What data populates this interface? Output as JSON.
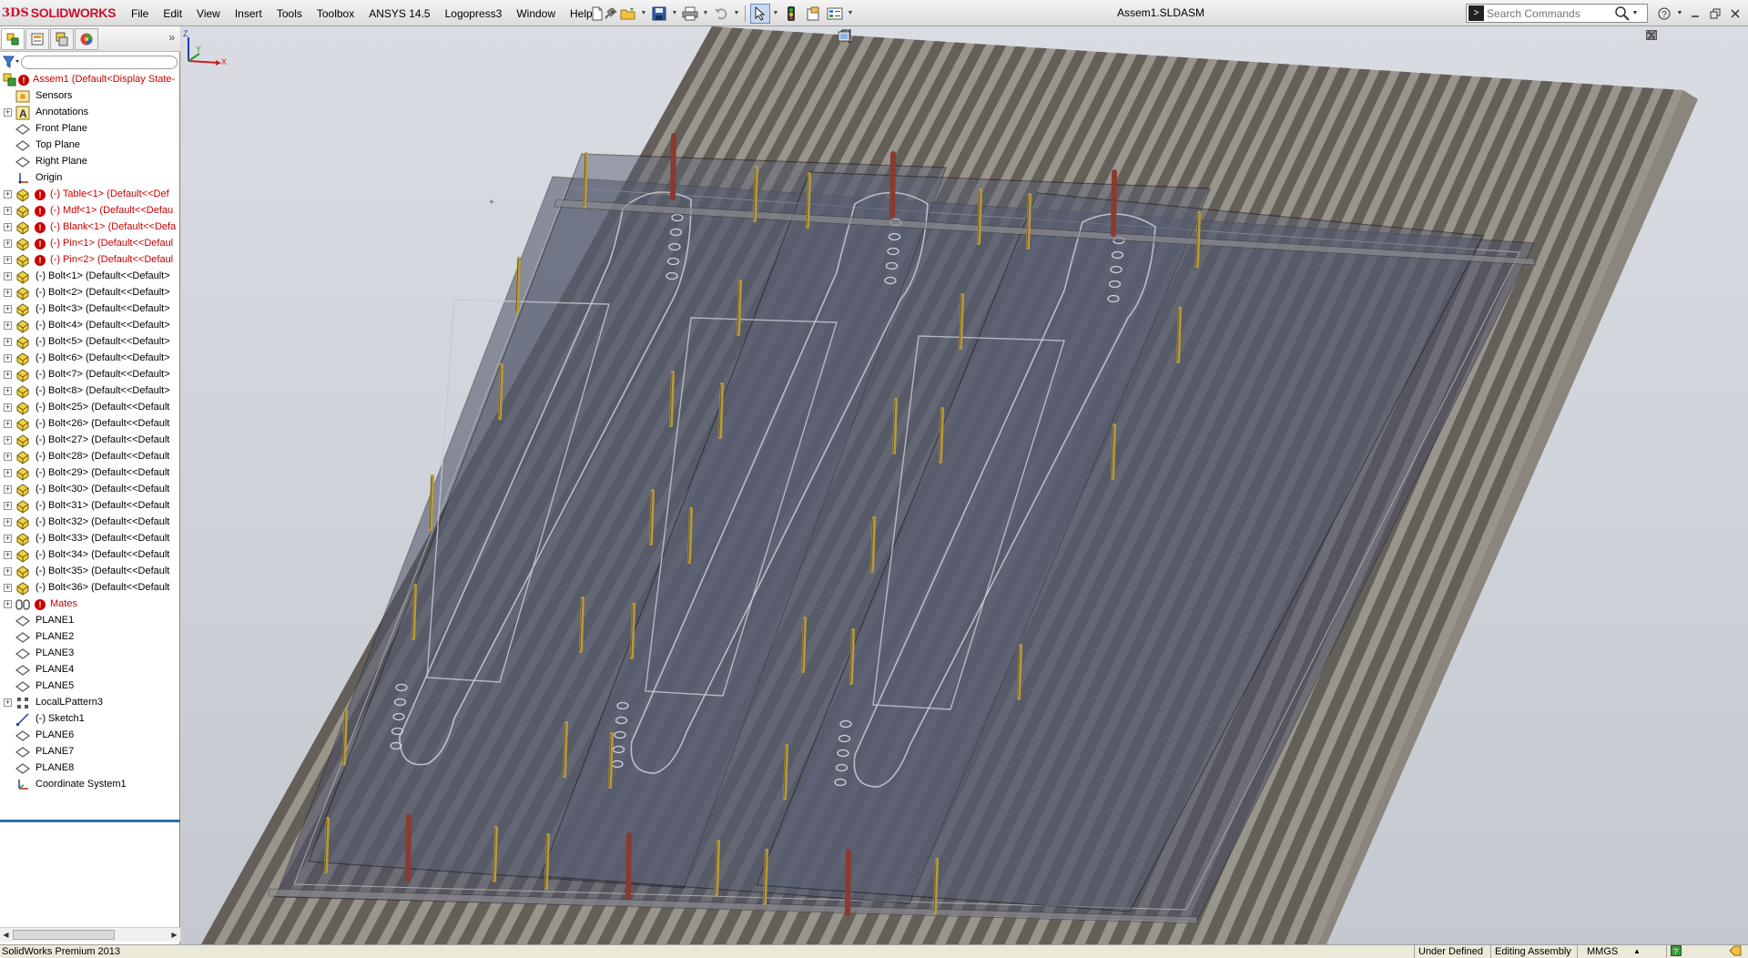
{
  "app": {
    "logo_mark": "3DS",
    "logo_text": "SOLIDWORKS",
    "document_title": "Assem1.SLDASM"
  },
  "menu": {
    "items": [
      "File",
      "Edit",
      "View",
      "Insert",
      "Tools",
      "Toolbox",
      "ANSYS 14.5",
      "Logopress3",
      "Window",
      "Help"
    ]
  },
  "search": {
    "placeholder": "Search Commands"
  },
  "feature_tree": {
    "items": [
      {
        "label": "Assem1  (Default<Display State-",
        "icon": "assembly-icon",
        "error": true,
        "red": true
      },
      {
        "label": "Sensors",
        "icon": "sensors-icon"
      },
      {
        "label": "Annotations",
        "icon": "annotations-icon",
        "expand": true
      },
      {
        "label": "Front Plane",
        "icon": "plane-icon"
      },
      {
        "label": "Top Plane",
        "icon": "plane-icon"
      },
      {
        "label": "Right Plane",
        "icon": "plane-icon"
      },
      {
        "label": "Origin",
        "icon": "origin-icon"
      },
      {
        "label": "(-) Table<1> (Default<<Def",
        "icon": "part-icon",
        "expand": true,
        "error": true,
        "red": true
      },
      {
        "label": "(-) Mdf<1> (Default<<Defau",
        "icon": "part-icon",
        "expand": true,
        "error": true,
        "red": true
      },
      {
        "label": "(-) Blank<1> (Default<<Defa",
        "icon": "part-icon",
        "expand": true,
        "error": true,
        "red": true
      },
      {
        "label": "(-) Pin<1> (Default<<Defaul",
        "icon": "part-icon",
        "expand": true,
        "error": true,
        "red": true
      },
      {
        "label": "(-) Pin<2> (Default<<Defaul",
        "icon": "part-icon",
        "expand": true,
        "error": true,
        "red": true
      },
      {
        "label": "(-) Bolt<1> (Default<<Default>",
        "icon": "part-icon",
        "expand": true
      },
      {
        "label": "(-) Bolt<2> (Default<<Default>",
        "icon": "part-icon",
        "expand": true
      },
      {
        "label": "(-) Bolt<3> (Default<<Default>",
        "icon": "part-icon",
        "expand": true
      },
      {
        "label": "(-) Bolt<4> (Default<<Default>",
        "icon": "part-icon",
        "expand": true
      },
      {
        "label": "(-) Bolt<5> (Default<<Default>",
        "icon": "part-icon",
        "expand": true
      },
      {
        "label": "(-) Bolt<6> (Default<<Default>",
        "icon": "part-icon",
        "expand": true
      },
      {
        "label": "(-) Bolt<7> (Default<<Default>",
        "icon": "part-icon",
        "expand": true
      },
      {
        "label": "(-) Bolt<8> (Default<<Default>",
        "icon": "part-icon",
        "expand": true
      },
      {
        "label": "(-) Bolt<25> (Default<<Default",
        "icon": "part-icon",
        "expand": true
      },
      {
        "label": "(-) Bolt<26> (Default<<Default",
        "icon": "part-icon",
        "expand": true
      },
      {
        "label": "(-) Bolt<27> (Default<<Default",
        "icon": "part-icon",
        "expand": true
      },
      {
        "label": "(-) Bolt<28> (Default<<Default",
        "icon": "part-icon",
        "expand": true
      },
      {
        "label": "(-) Bolt<29> (Default<<Default",
        "icon": "part-icon",
        "expand": true
      },
      {
        "label": "(-) Bolt<30> (Default<<Default",
        "icon": "part-icon",
        "expand": true
      },
      {
        "label": "(-) Bolt<31> (Default<<Default",
        "icon": "part-icon",
        "expand": true
      },
      {
        "label": "(-) Bolt<32> (Default<<Default",
        "icon": "part-icon",
        "expand": true
      },
      {
        "label": "(-) Bolt<33> (Default<<Default",
        "icon": "part-icon",
        "expand": true
      },
      {
        "label": "(-) Bolt<34> (Default<<Default",
        "icon": "part-icon",
        "expand": true
      },
      {
        "label": "(-) Bolt<35> (Default<<Default",
        "icon": "part-icon",
        "expand": true
      },
      {
        "label": "(-) Bolt<36> (Default<<Default",
        "icon": "part-icon",
        "expand": true
      },
      {
        "label": "Mates",
        "icon": "mates-icon",
        "expand": true,
        "error": true,
        "red": true
      },
      {
        "label": "PLANE1",
        "icon": "plane-icon"
      },
      {
        "label": "PLANE2",
        "icon": "plane-icon"
      },
      {
        "label": "PLANE3",
        "icon": "plane-icon"
      },
      {
        "label": "PLANE4",
        "icon": "plane-icon"
      },
      {
        "label": "PLANE5",
        "icon": "plane-icon"
      },
      {
        "label": "LocalLPattern3",
        "icon": "pattern-icon",
        "expand": true
      },
      {
        "label": "(-) Sketch1",
        "icon": "sketch-icon"
      },
      {
        "label": "PLANE6",
        "icon": "plane-icon"
      },
      {
        "label": "PLANE7",
        "icon": "plane-icon"
      },
      {
        "label": "PLANE8",
        "icon": "plane-icon"
      },
      {
        "label": "Coordinate System1",
        "icon": "coordinate-system-icon"
      }
    ]
  },
  "status": {
    "product": "SolidWorks Premium 2013",
    "definition": "Under Defined",
    "mode": "Editing Assembly",
    "units": "MMGS",
    "units_arrow": "▲"
  },
  "triad": {
    "x": "X",
    "y": "Y",
    "z": "Z"
  },
  "colors": {
    "error_red": "#c80000",
    "brand_red": "#c8102e",
    "slat_dark": "#5a5650",
    "slat_light": "#9a958c",
    "glass": "#4a5064",
    "bolt": "#b89a3c",
    "pin": "#8a3a30"
  }
}
